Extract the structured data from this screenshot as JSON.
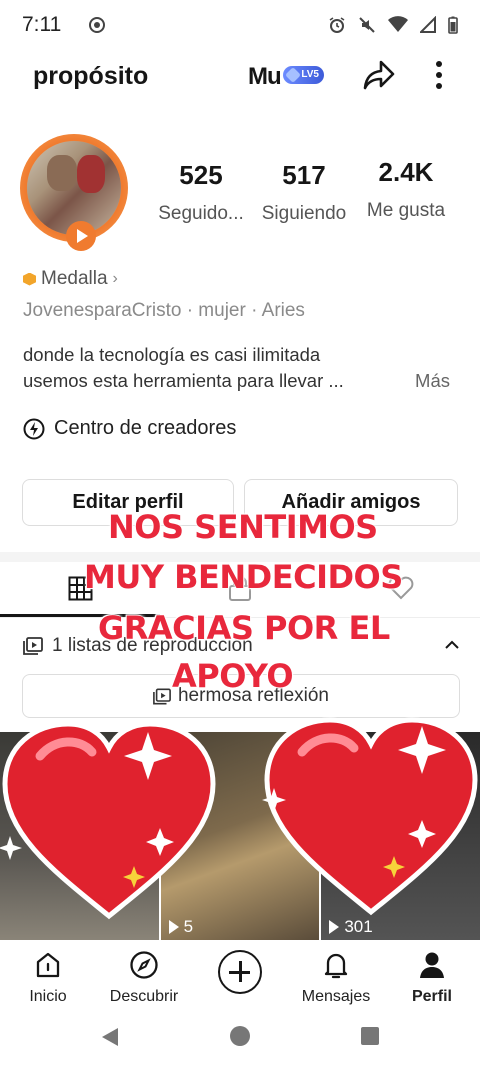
{
  "status_bar": {
    "time": "7:11"
  },
  "header": {
    "title": "propósito",
    "logo_text": "Mu",
    "level_badge": "LV5",
    "share_icon": "share-arrow-icon",
    "more_icon": "more-vertical-icon"
  },
  "profile": {
    "stats": [
      {
        "value": "525",
        "label": "Seguido..."
      },
      {
        "value": "517",
        "label": "Siguiendo"
      },
      {
        "value": "2.4K",
        "label": "Me gusta"
      }
    ],
    "medal_label": "Medalla",
    "meta": "JovenesparaCristo · mujer · Aries",
    "bio_line1": "donde la tecnología es casi ilimitada",
    "bio_line2": "usemos esta herramienta para llevar ...",
    "bio_more": "Más",
    "creators_center": "Centro de creadores",
    "edit_profile": "Editar perfil",
    "add_friends": "Añadir amigos"
  },
  "tabs": [
    {
      "name": "videos",
      "icon": "grid-icon",
      "active": true
    },
    {
      "name": "private",
      "icon": "lock-icon",
      "active": false
    },
    {
      "name": "liked",
      "icon": "heart-outline-icon",
      "active": false
    }
  ],
  "playlists": {
    "header": "1 listas de reproducción",
    "chip": "hermosa reflexión"
  },
  "videos": [
    {
      "views": ""
    },
    {
      "views": "5"
    },
    {
      "views": "301"
    }
  ],
  "overlay_text": {
    "line1": "NOS SENTIMOS",
    "line2": "MUY BENDECIDOS",
    "line3": "GRACIAS POR EL",
    "line4": "APOYO"
  },
  "bottom_nav": [
    {
      "label": "Inicio",
      "icon": "home-icon"
    },
    {
      "label": "Descubrir",
      "icon": "compass-icon"
    },
    {
      "label": "",
      "icon": "plus-icon"
    },
    {
      "label": "Mensajes",
      "icon": "bell-icon"
    },
    {
      "label": "Perfil",
      "icon": "person-icon",
      "active": true
    }
  ],
  "colors": {
    "overlay_red": "#e8283c",
    "accent_orange": "#f07b2f",
    "medal_gold": "#f2a52b"
  }
}
